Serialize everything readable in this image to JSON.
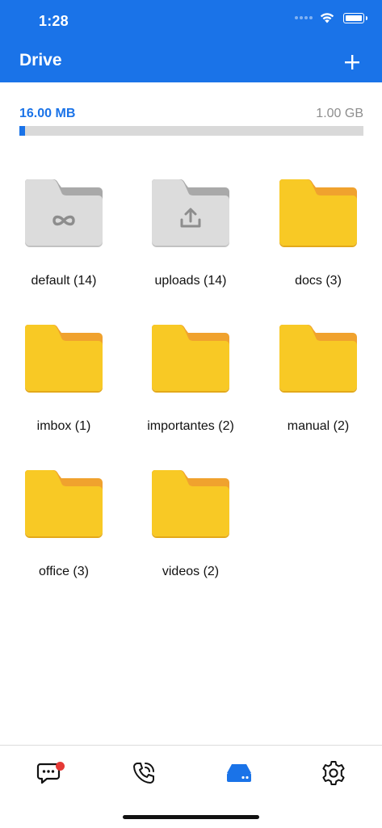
{
  "status": {
    "time": "1:28"
  },
  "header": {
    "title": "Drive",
    "add_icon": "plus-icon"
  },
  "storage": {
    "used": "16.00 MB",
    "total": "1.00 GB",
    "used_fraction": 0.016
  },
  "folders": [
    {
      "label": "default (14)",
      "kind": "system-default",
      "icon": "infinity-icon"
    },
    {
      "label": "uploads (14)",
      "kind": "system-uploads",
      "icon": "upload-icon"
    },
    {
      "label": "docs (3)",
      "kind": "folder"
    },
    {
      "label": "imbox (1)",
      "kind": "folder"
    },
    {
      "label": "importantes (2)",
      "kind": "folder"
    },
    {
      "label": "manual (2)",
      "kind": "folder"
    },
    {
      "label": "office (3)",
      "kind": "folder"
    },
    {
      "label": "videos (2)",
      "kind": "folder"
    }
  ],
  "tabbar": {
    "items": [
      {
        "name": "chat",
        "icon": "chat-bubble-icon",
        "badge": true
      },
      {
        "name": "calls",
        "icon": "phone-call-icon",
        "badge": false
      },
      {
        "name": "drive",
        "icon": "drive-icon",
        "badge": false,
        "active": true
      },
      {
        "name": "settings",
        "icon": "gear-icon",
        "badge": false
      }
    ]
  },
  "colors": {
    "accent": "#1a73e8",
    "folder_yellow": "#f8c925",
    "folder_orange": "#f0a22e",
    "folder_gray": "#d8d8d8",
    "badge": "#e53935"
  }
}
